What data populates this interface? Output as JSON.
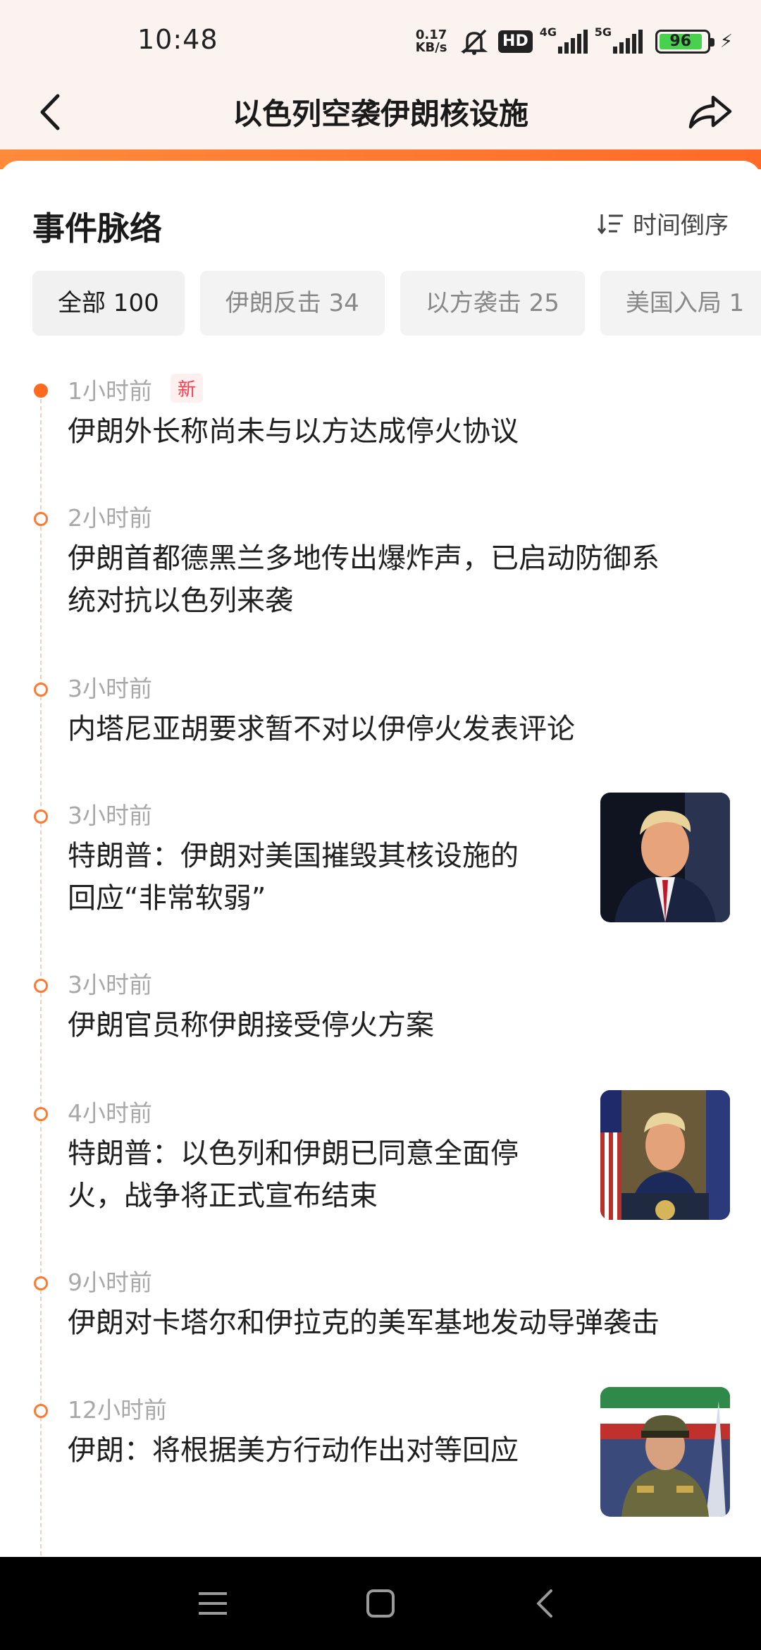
{
  "status_bar": {
    "time": "10:48",
    "net_speed_value": "0.17",
    "net_speed_unit": "KB/s",
    "hd_badge": "HD",
    "sim1_type": "4G",
    "sim2_type": "5G",
    "battery_level": "96"
  },
  "header": {
    "title": "以色列空袭伊朗核设施"
  },
  "section": {
    "title": "事件脉络",
    "sort_label": "时间倒序"
  },
  "filters": [
    {
      "label": "全部 100",
      "active": true
    },
    {
      "label": "伊朗反击 34",
      "active": false
    },
    {
      "label": "以方袭击 25",
      "active": false
    },
    {
      "label": "美国入局 1",
      "active": false
    }
  ],
  "timeline": [
    {
      "time": "1小时前",
      "badge": "新",
      "title_lines": [
        "伊朗外长称尚未与以方达成停火协议"
      ],
      "thumb": null
    },
    {
      "time": "2小时前",
      "badge": null,
      "title_lines": [
        "伊朗首都德黑兰多地传出爆炸声，已启动防御系",
        "统对抗以色列来袭"
      ],
      "thumb": null
    },
    {
      "time": "3小时前",
      "badge": null,
      "title_lines": [
        "内塔尼亚胡要求暂不对以伊停火发表评论"
      ],
      "thumb": null
    },
    {
      "time": "3小时前",
      "badge": null,
      "title_lines": [
        "特朗普：伊朗对美国摧毁其核设施的",
        "回应“非常软弱”"
      ],
      "thumb": "portrait-dark"
    },
    {
      "time": "3小时前",
      "badge": null,
      "title_lines": [
        "伊朗官员称伊朗接受停火方案"
      ],
      "thumb": null
    },
    {
      "time": "4小时前",
      "badge": null,
      "title_lines": [
        "特朗普：以色列和伊朗已同意全面停",
        "火，战争将正式宣布结束"
      ],
      "thumb": "podium"
    },
    {
      "time": "9小时前",
      "badge": null,
      "title_lines": [
        "伊朗对卡塔尔和伊拉克的美军基地发动导弹袭击"
      ],
      "thumb": null
    },
    {
      "time": "12小时前",
      "badge": null,
      "title_lines": [
        "伊朗：将根据美方行动作出对等回应"
      ],
      "thumb": "military"
    }
  ],
  "colors": {
    "accent": "#ff6a28",
    "dot_new": "#ff6a1f",
    "badge_new": "#ff3b4a",
    "timestamp": "#a8a8a8"
  },
  "icons": {
    "back": "arrow-left-icon",
    "share": "share-arrow-icon",
    "sort": "sort-desc-icon",
    "nav_menu": "menu-icon",
    "nav_home": "home-square-icon",
    "nav_back": "back-chevron-icon"
  }
}
